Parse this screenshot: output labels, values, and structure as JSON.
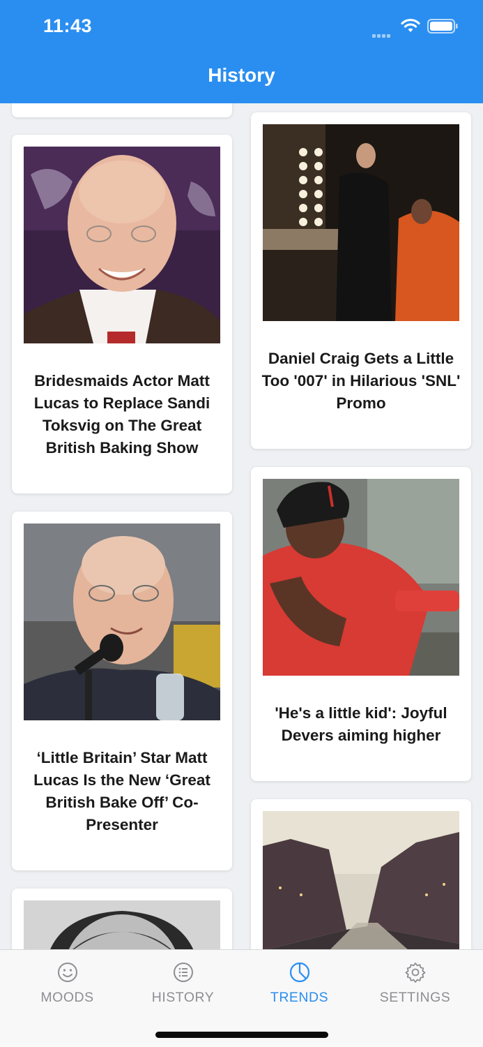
{
  "status_bar": {
    "time": "11:43",
    "icons": [
      "signal-dots-icon",
      "wifi-icon",
      "battery-icon"
    ]
  },
  "header": {
    "title": "History",
    "background": "#2a8ef0"
  },
  "articles": [
    {
      "title": "Bridesmaids Actor Matt Lucas to Replace Sandi Toksvig on The Great British Baking Show",
      "image": "portrait-bald-man-smiling"
    },
    {
      "title": "Daniel Craig Gets a Little Too '007' in Hilarious 'SNL' Promo",
      "image": "backstage-dressing-room"
    },
    {
      "title": "‘Little Britain’ Star Matt Lucas Is the New ‘Great British Bake Off’ Co-Presenter",
      "image": "man-at-microphone"
    },
    {
      "title": "'He's a little kid': Joyful Devers aiming higher",
      "image": "baseball-player-red-jersey"
    },
    {
      "title": "",
      "image": "grayscale-portrait"
    },
    {
      "title": "",
      "image": "canal-city-street"
    }
  ],
  "tabbar": {
    "tabs": [
      {
        "label": "MOODS",
        "icon": "smiley-icon",
        "active": false
      },
      {
        "label": "HISTORY",
        "icon": "list-icon",
        "active": false
      },
      {
        "label": "TRENDS",
        "icon": "pie-chart-icon",
        "active": true
      },
      {
        "label": "SETTINGS",
        "icon": "gear-icon",
        "active": false
      }
    ],
    "active_color": "#2a8ef0",
    "inactive_color": "#8e8e93"
  }
}
